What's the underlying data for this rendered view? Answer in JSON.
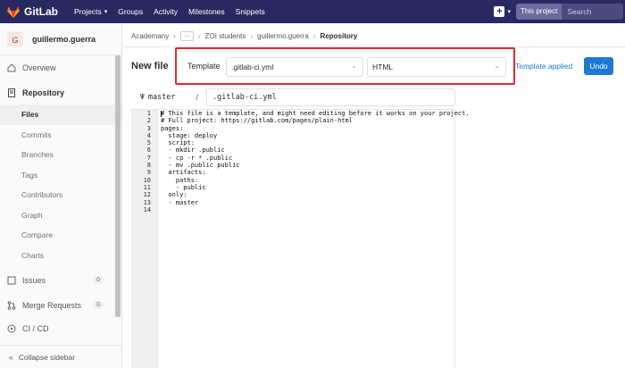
{
  "nav": {
    "brand": "GitLab",
    "links": [
      "Projects",
      "Groups",
      "Activity",
      "Milestones",
      "Snippets"
    ],
    "search_scope": "This project",
    "search_placeholder": "Search"
  },
  "sidebar": {
    "avatar_letter": "G",
    "user": "guillermo.guerra",
    "overview": "Overview",
    "repository": "Repository",
    "sub_items": [
      "Files",
      "Commits",
      "Branches",
      "Tags",
      "Contributors",
      "Graph",
      "Compare",
      "Charts"
    ],
    "issues": "Issues",
    "issues_count": "0",
    "merge_requests": "Merge Requests",
    "merge_requests_count": "0",
    "cicd": "CI / CD",
    "collapse": "Collapse sidebar"
  },
  "breadcrumb": {
    "items": [
      "Academany",
      "ZOI students",
      "guillermo.guerra",
      "Repository"
    ],
    "more": "···"
  },
  "page": {
    "title": "New file",
    "template_label": "Template",
    "template_type": ".gitlab-ci.yml",
    "template_name": "HTML",
    "template_applied": "Template applied",
    "undo": "Undo"
  },
  "editor": {
    "branch": "master",
    "path_sep": "/",
    "filename": ".gitlab-ci.yml",
    "lines": [
      "# This file is a template, and might need editing before it works on your project.",
      "# Full project: https://gitlab.com/pages/plain-html",
      "pages:",
      "  stage: deploy",
      "  script:",
      "  - mkdir .public",
      "  - cp -r * .public",
      "  - mv .public public",
      "  artifacts:",
      "    paths:",
      "    - public",
      "  only:",
      "  - master",
      ""
    ]
  },
  "colors": {
    "navbar": "#292961",
    "primary": "#1f78d1",
    "highlight": "#e02a33"
  }
}
